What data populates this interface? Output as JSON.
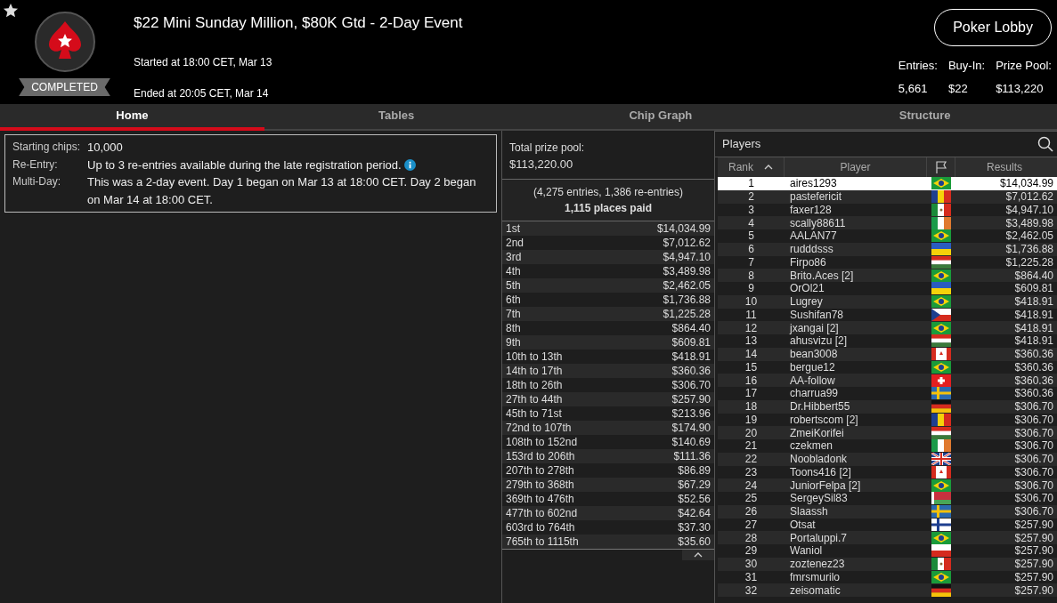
{
  "header": {
    "favorite": true,
    "status": "COMPLETED",
    "title": "$22 Mini Sunday Million, $80K Gtd - 2-Day Event",
    "started": "Started at 18:00 CET, Mar 13",
    "ended": "Ended at 20:05 CET, Mar 14",
    "lobby_button": "Poker Lobby",
    "stats": [
      {
        "label": "Entries:",
        "value": "5,661"
      },
      {
        "label": "Buy-In:",
        "value": "$22"
      },
      {
        "label": "Prize Pool:",
        "value": "$113,220"
      }
    ]
  },
  "tabs": [
    {
      "label": "Home",
      "selected": true
    },
    {
      "label": "Tables",
      "selected": false
    },
    {
      "label": "Chip Graph",
      "selected": false
    },
    {
      "label": "Structure",
      "selected": false
    }
  ],
  "info": [
    {
      "label": "Starting chips:",
      "value": "10,000",
      "info": false
    },
    {
      "label": "Re-Entry:",
      "value": "Up to 3 re-entries available during the late registration period.",
      "info": true
    },
    {
      "label": "Multi-Day:",
      "value": "This was a 2-day event. Day 1 began on Mar 13 at 18:00 CET. Day 2 began on Mar 14 at 18:00 CET.",
      "info": false
    }
  ],
  "prizes": {
    "total_label": "Total prize pool:",
    "total": "$113,220.00",
    "entries": "(4,275 entries, 1,386 re-entries)",
    "places": "1,115 places paid",
    "rows": [
      {
        "place": "1st",
        "amount": "$14,034.99"
      },
      {
        "place": "2nd",
        "amount": "$7,012.62"
      },
      {
        "place": "3rd",
        "amount": "$4,947.10"
      },
      {
        "place": "4th",
        "amount": "$3,489.98"
      },
      {
        "place": "5th",
        "amount": "$2,462.05"
      },
      {
        "place": "6th",
        "amount": "$1,736.88"
      },
      {
        "place": "7th",
        "amount": "$1,225.28"
      },
      {
        "place": "8th",
        "amount": "$864.40"
      },
      {
        "place": "9th",
        "amount": "$609.81"
      },
      {
        "place": "10th to 13th",
        "amount": "$418.91"
      },
      {
        "place": "14th to 17th",
        "amount": "$360.36"
      },
      {
        "place": "18th to 26th",
        "amount": "$306.70"
      },
      {
        "place": "27th to 44th",
        "amount": "$257.90"
      },
      {
        "place": "45th to 71st",
        "amount": "$213.96"
      },
      {
        "place": "72nd to 107th",
        "amount": "$174.90"
      },
      {
        "place": "108th to 152nd",
        "amount": "$140.69"
      },
      {
        "place": "153rd to 206th",
        "amount": "$111.36"
      },
      {
        "place": "207th to 278th",
        "amount": "$86.89"
      },
      {
        "place": "279th to 368th",
        "amount": "$67.29"
      },
      {
        "place": "369th to 476th",
        "amount": "$52.56"
      },
      {
        "place": "477th to 602nd",
        "amount": "$42.64"
      },
      {
        "place": "603rd to 764th",
        "amount": "$37.30"
      },
      {
        "place": "765th to 1115th",
        "amount": "$35.60"
      }
    ]
  },
  "players": {
    "title": "Players",
    "columns": [
      "Rank",
      "Player",
      "Results"
    ],
    "rows": [
      {
        "rank": "1",
        "player": "aires1293",
        "kind": "br",
        "result": "$14,034.99",
        "selected": true
      },
      {
        "rank": "2",
        "player": "pastefericit",
        "kind": "ro",
        "result": "$7,012.62",
        "selected": false
      },
      {
        "rank": "3",
        "player": "faxer128",
        "kind": "mx",
        "result": "$4,947.10",
        "selected": false
      },
      {
        "rank": "4",
        "player": "scally88611",
        "kind": "ie",
        "result": "$3,489.98",
        "selected": false
      },
      {
        "rank": "5",
        "player": "AALAN77",
        "kind": "br",
        "result": "$2,462.05",
        "selected": false
      },
      {
        "rank": "6",
        "player": "rudddsss",
        "kind": "ua",
        "result": "$1,736.88",
        "selected": false
      },
      {
        "rank": "7",
        "player": "Firpo86",
        "kind": "hu",
        "result": "$1,225.28",
        "selected": false
      },
      {
        "rank": "8",
        "player": "Brito.Aces [2]",
        "kind": "br",
        "result": "$864.40",
        "selected": false
      },
      {
        "rank": "9",
        "player": "OrOl21",
        "kind": "ua",
        "result": "$609.81",
        "selected": false
      },
      {
        "rank": "10",
        "player": "Lugrey",
        "kind": "br",
        "result": "$418.91",
        "selected": false
      },
      {
        "rank": "11",
        "player": "Sushifan78",
        "kind": "cz",
        "result": "$418.91",
        "selected": false
      },
      {
        "rank": "12",
        "player": "jxangai [2]",
        "kind": "br",
        "result": "$418.91",
        "selected": false
      },
      {
        "rank": "13",
        "player": "ahusvizu [2]",
        "kind": "hu",
        "result": "$418.91",
        "selected": false
      },
      {
        "rank": "14",
        "player": "bean3008",
        "kind": "ca",
        "result": "$360.36",
        "selected": false
      },
      {
        "rank": "15",
        "player": "bergue12",
        "kind": "br",
        "result": "$360.36",
        "selected": false
      },
      {
        "rank": "16",
        "player": "AA-follow",
        "kind": "ch",
        "result": "$360.36",
        "selected": false
      },
      {
        "rank": "17",
        "player": "charrua99",
        "kind": "se",
        "result": "$360.36",
        "selected": false
      },
      {
        "rank": "18",
        "player": "Dr.Hibbert55",
        "kind": "de",
        "result": "$306.70",
        "selected": false
      },
      {
        "rank": "19",
        "player": "robertscom [2]",
        "kind": "ro",
        "result": "$306.70",
        "selected": false
      },
      {
        "rank": "20",
        "player": "ZmeiKorifei",
        "kind": "hu",
        "result": "$306.70",
        "selected": false
      },
      {
        "rank": "21",
        "player": "czekmen",
        "kind": "ie",
        "result": "$306.70",
        "selected": false
      },
      {
        "rank": "22",
        "player": "Noobladonk",
        "kind": "gb",
        "result": "$306.70",
        "selected": false
      },
      {
        "rank": "23",
        "player": "Toons416 [2]",
        "kind": "ca",
        "result": "$306.70",
        "selected": false
      },
      {
        "rank": "24",
        "player": "JuniorFelpa [2]",
        "kind": "br",
        "result": "$306.70",
        "selected": false
      },
      {
        "rank": "25",
        "player": "SergeySil83",
        "kind": "by",
        "result": "$306.70",
        "selected": false
      },
      {
        "rank": "26",
        "player": "Slaassh",
        "kind": "se",
        "result": "$306.70",
        "selected": false
      },
      {
        "rank": "27",
        "player": "Otsat",
        "kind": "fi",
        "result": "$257.90",
        "selected": false
      },
      {
        "rank": "28",
        "player": "Portaluppi.7",
        "kind": "br",
        "result": "$257.90",
        "selected": false
      },
      {
        "rank": "29",
        "player": "Waniol",
        "kind": "pl",
        "result": "$257.90",
        "selected": false
      },
      {
        "rank": "30",
        "player": "zoztenez23",
        "kind": "mx",
        "result": "$257.90",
        "selected": false
      },
      {
        "rank": "31",
        "player": "fmrsmurilo",
        "kind": "br",
        "result": "$257.90",
        "selected": false
      },
      {
        "rank": "32",
        "player": "zeisomatic",
        "kind": "de",
        "result": "$257.90",
        "selected": false
      }
    ]
  }
}
